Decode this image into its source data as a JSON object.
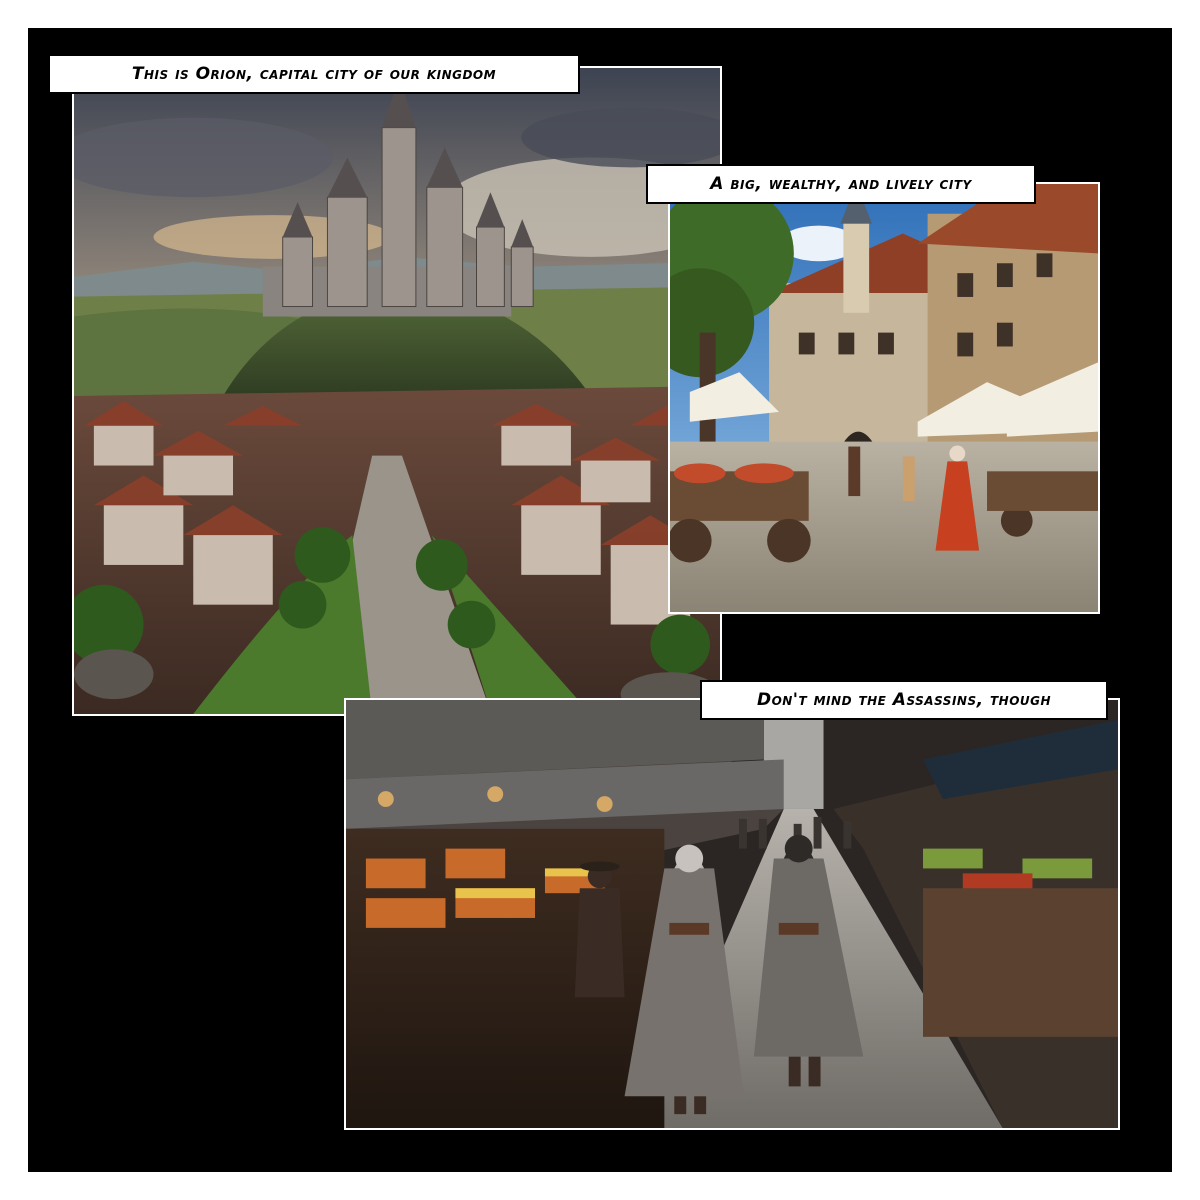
{
  "comic_page": {
    "panels": [
      {
        "caption": "This is Orion, capital city of our kingdom",
        "scene": "castle-overview"
      },
      {
        "caption": "A big, wealthy, and lively city",
        "scene": "market-square"
      },
      {
        "caption": "Don't mind the Assassins, though",
        "scene": "market-street"
      }
    ],
    "colors": {
      "background": "#000000",
      "page": "#ffffff",
      "caption_bg": "#ffffff",
      "caption_text": "#000000"
    }
  }
}
